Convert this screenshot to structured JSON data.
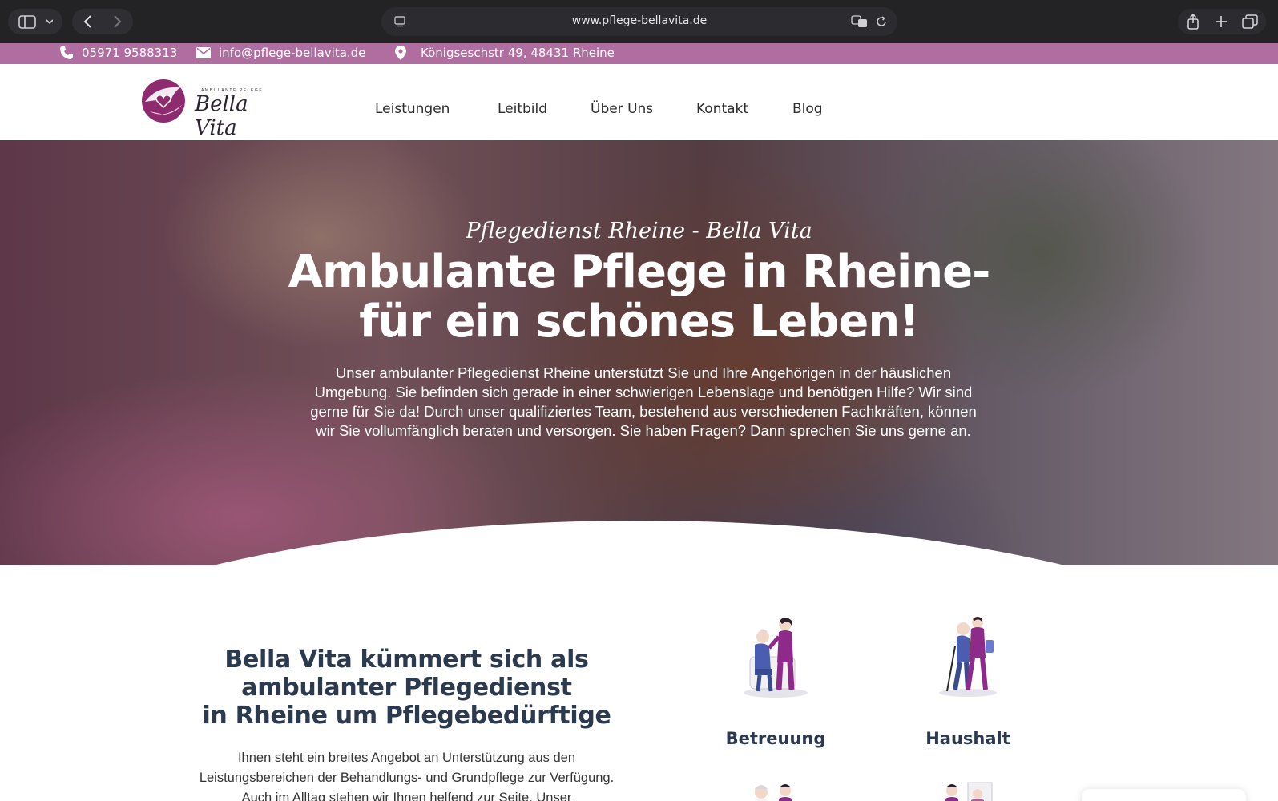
{
  "browser": {
    "url": "www.pflege-bellavita.de"
  },
  "topbar": {
    "phone": "05971 9588313",
    "email": "info@pflege-bellavita.de",
    "address": "Königseschstr 49, 48431 Rheine",
    "color": "#b06ea0"
  },
  "logo": {
    "tagline": "AMBULANTE PFLEGE",
    "name": "Bella Vita"
  },
  "nav": {
    "items": [
      "Leistungen",
      "Leitbild",
      "Über Uns",
      "Kontakt",
      "Blog"
    ]
  },
  "hero": {
    "subtitle": "Pflegedienst Rheine - Bella Vita",
    "title_line1": "Ambulante Pflege in Rheine-",
    "title_line2": "für ein schönes Leben!",
    "text": "Unser ambulanter Pflegedienst Rheine unterstützt Sie und Ihre Angehörigen in der häuslichen Umgebung. Sie befinden sich gerade in einer schwierigen Lebenslage und benötigen Hilfe? Wir sind gerne für Sie da! Durch unser qualifiziertes Team, bestehend aus verschiedenen Fachkräften, können wir Sie vollumfänglich beraten und versorgen. Sie haben Fragen? Dann sprechen Sie uns gerne an."
  },
  "intro": {
    "title_line1": "Bella Vita kümmert sich als",
    "title_line2": "ambulanter Pflegedienst",
    "title_line3": "in Rheine um Pflegebedürftige",
    "text": "Ihnen steht ein breites Angebot an Unterstützung aus den Leistungsbereichen der Behandlungs- und Grundpflege zur Verfügung. Auch im Alltag stehen wir Ihnen helfend zur Seite. Unser"
  },
  "services": [
    {
      "label": "Betreuung",
      "icon": "caregiver-seated-illustration"
    },
    {
      "label": "Haushalt",
      "icon": "caregiver-walking-illustration"
    }
  ],
  "colors": {
    "brand": "#b06ea0",
    "heading": "#2b3a4e",
    "purple_uniform": "#8e2a8a"
  }
}
